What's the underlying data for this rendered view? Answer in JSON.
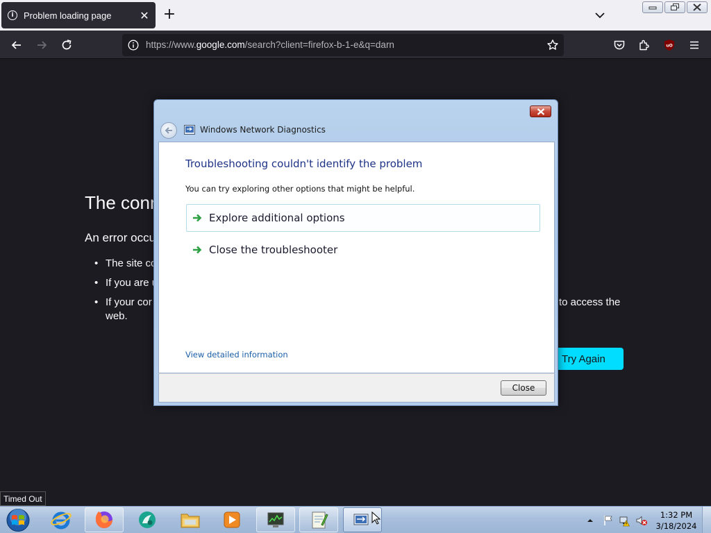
{
  "browser": {
    "tab_title": "Problem loading page",
    "url_prefix": "https://www.",
    "url_domain": "google.com",
    "url_suffix": "/search?client=firefox-b-1-e&q=darn"
  },
  "error_page": {
    "title_visible": "The conn",
    "subtitle_visible": "An error occu",
    "bullets_visible": [
      "The site cc",
      "If you are u",
      "If your cor"
    ],
    "bullet3_tail": "to access the",
    "bullet3_wrap": "web.",
    "try_again_label": "Try Again"
  },
  "dialog": {
    "window_title": "Windows Network Diagnostics",
    "heading": "Troubleshooting couldn't identify the problem",
    "description": "You can try exploring other options that might be helpful.",
    "options": [
      {
        "label": "Explore additional options"
      },
      {
        "label": "Close the troubleshooter"
      }
    ],
    "details_link": "View detailed information",
    "close_button": "Close"
  },
  "tooltip": "Timed Out",
  "taskbar": {
    "time": "1:32 PM",
    "date": "3/18/2024"
  },
  "colors": {
    "accent_try_again": "#00ddff",
    "dialog_heading": "#1e3287",
    "link": "#1c5fa8"
  }
}
